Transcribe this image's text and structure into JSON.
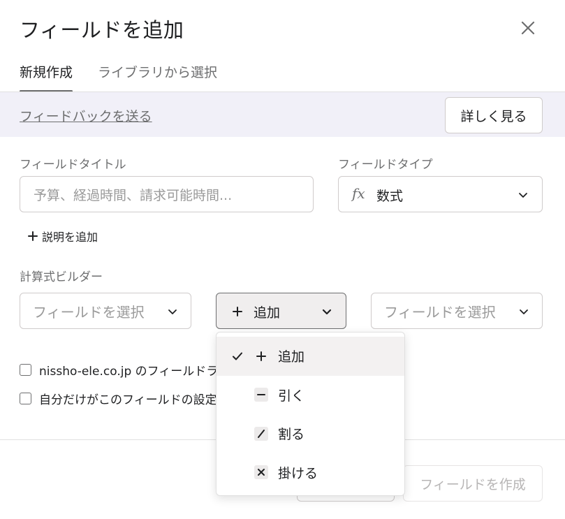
{
  "dialog": {
    "title": "フィールドを追加",
    "close_icon": "close-icon"
  },
  "tabs": [
    {
      "label": "新規作成",
      "active": true
    },
    {
      "label": "ライブラリから選択",
      "active": false
    }
  ],
  "feedback": {
    "link_label": "フィードバックを送る",
    "learn_more_label": "詳しく見る"
  },
  "form": {
    "field_title_label": "フィールドタイトル",
    "field_title_placeholder": "予算、経過時間、請求可能時間...",
    "field_type_label": "フィールドタイプ",
    "field_type_icon": "fx-icon",
    "field_type_value": "数式",
    "add_description_label": "説明を追加",
    "formula_builder_label": "計算式ビルダー",
    "left_field_placeholder": "フィールドを選択",
    "operator_value": "追加",
    "right_field_placeholder": "フィールドを選択"
  },
  "checkboxes": [
    {
      "label": "nissho-ele.co.jp のフィールドライ",
      "checked": false
    },
    {
      "label": "自分だけがこのフィールドの設定",
      "checked": false
    }
  ],
  "footer": {
    "create_label": "フィールドを作成"
  },
  "operator_menu": [
    {
      "label": "追加",
      "icon": "plus-icon",
      "selected": true
    },
    {
      "label": "引く",
      "icon": "minus-icon",
      "selected": false
    },
    {
      "label": "割る",
      "icon": "divide-icon",
      "selected": false
    },
    {
      "label": "掛ける",
      "icon": "multiply-icon",
      "selected": false
    }
  ],
  "colors": {
    "text_primary": "#1e1f21",
    "text_secondary": "#6d6e6f",
    "border": "#cfcbcb",
    "feedback_bg": "#f1f0f8"
  }
}
